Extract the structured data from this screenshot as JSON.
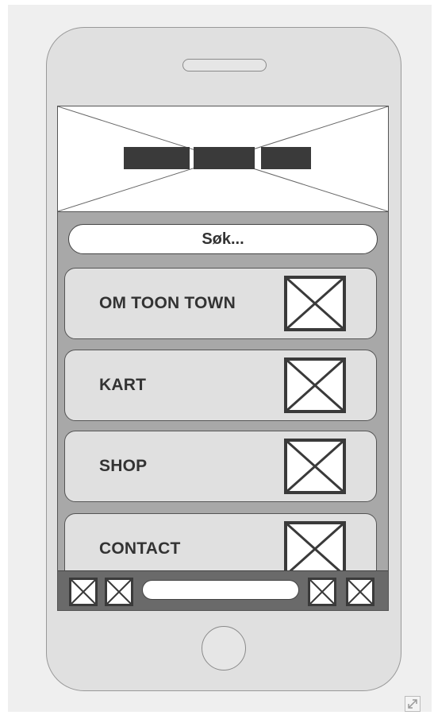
{
  "search": {
    "placeholder": "Søk..."
  },
  "menu": {
    "items": [
      {
        "label": "OM TOON TOWN",
        "icon": "image-placeholder-icon"
      },
      {
        "label": "KART",
        "icon": "image-placeholder-icon"
      },
      {
        "label": "SHOP",
        "icon": "image-placeholder-icon"
      },
      {
        "label": "CONTACT",
        "icon": "image-placeholder-icon"
      }
    ]
  },
  "toolbar": {
    "left_icons": [
      "image-placeholder-icon",
      "image-placeholder-icon"
    ],
    "right_icons": [
      "image-placeholder-icon",
      "image-placeholder-icon"
    ]
  },
  "colors": {
    "phone_body": "#e0e0e0",
    "screen_background": "#a8a8a8",
    "title_bar": "#3a3a3a",
    "toolbar": "#6a6a6a"
  }
}
